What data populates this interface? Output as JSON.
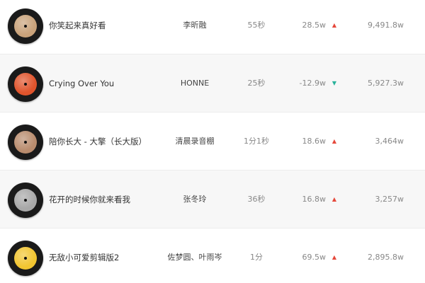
{
  "colors": {
    "up": "#e5483b",
    "down": "#2ab29b",
    "row_alt_bg": "#f7f7f7"
  },
  "rows": [
    {
      "title": "你笑起来真好看",
      "artist": "李昕融",
      "duration": "55秒",
      "change": "28.5w",
      "trend": "up",
      "trend_icon": "▲",
      "total": "9,491.8w",
      "cover_icon": "album-cover-icon",
      "cover_color": "#c9a27a"
    },
    {
      "title": "Crying Over You",
      "artist": "HONNE",
      "duration": "25秒",
      "change": "-12.9w",
      "trend": "down",
      "trend_icon": "▼",
      "total": "5,927.3w",
      "cover_icon": "album-cover-icon",
      "cover_color": "#e0542c"
    },
    {
      "title": "陪你长大 - 大擎（长大版）",
      "artist": "清晨录音棚",
      "duration": "1分1秒",
      "change": "18.6w",
      "trend": "up",
      "trend_icon": "▲",
      "total": "3,464w",
      "cover_icon": "album-cover-icon",
      "cover_color": "#b98c6e"
    },
    {
      "title": "花开的时候你就来看我",
      "artist": "张冬玲",
      "duration": "36秒",
      "change": "16.8w",
      "trend": "up",
      "trend_icon": "▲",
      "total": "3,257w",
      "cover_icon": "album-cover-icon",
      "cover_color": "#a8a8a8"
    },
    {
      "title": "无敌小可爱剪辑版2",
      "artist": "佐梦圆、叶雨岑",
      "duration": "1分",
      "change": "69.5w",
      "trend": "up",
      "trend_icon": "▲",
      "total": "2,895.8w",
      "cover_icon": "album-cover-icon",
      "cover_color": "#f2c531"
    }
  ]
}
